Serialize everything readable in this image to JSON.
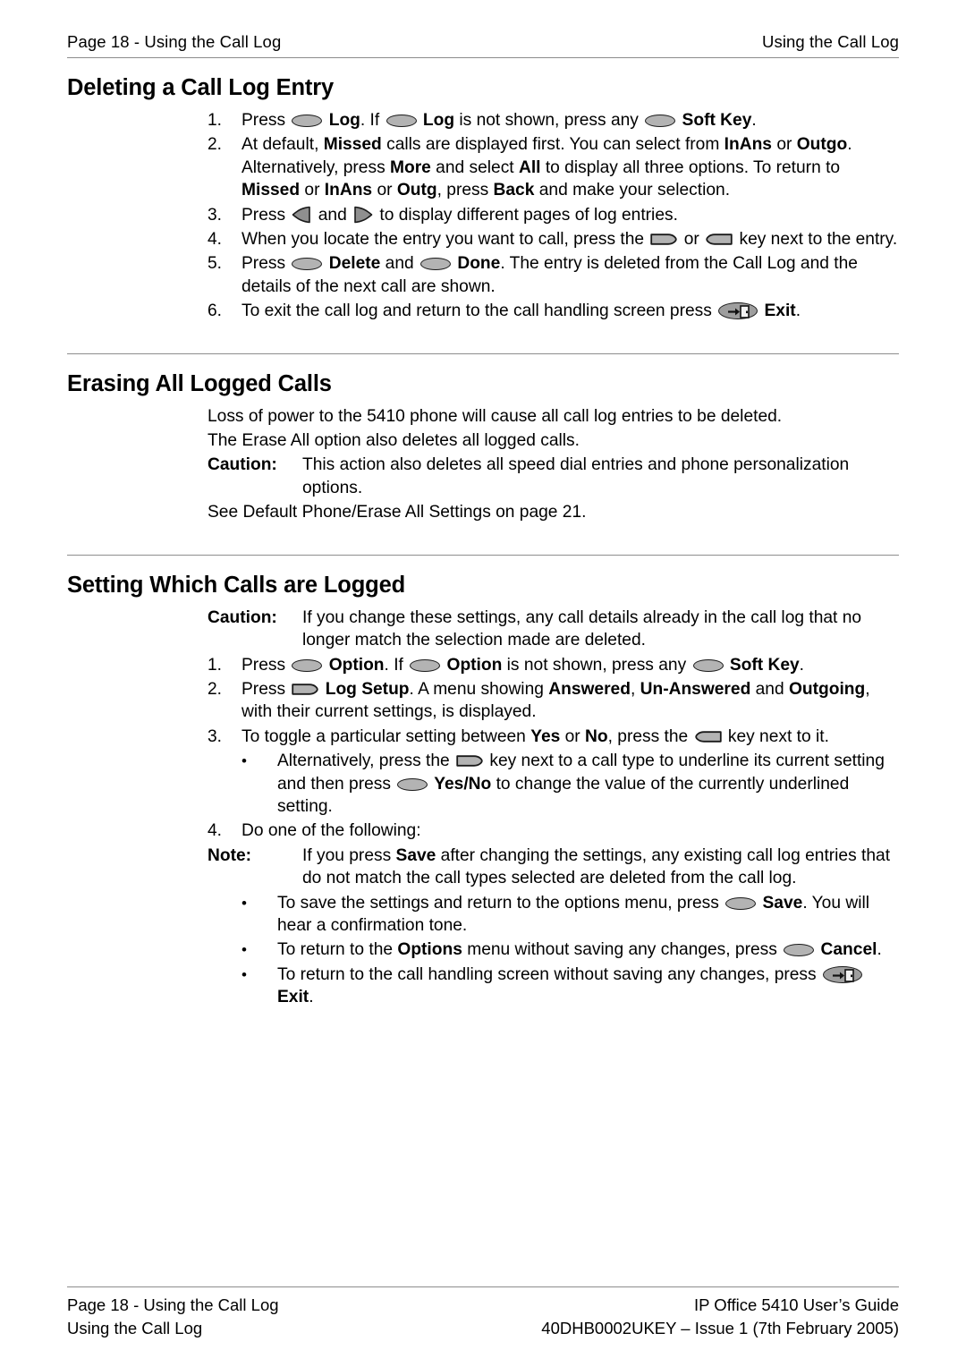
{
  "header": {
    "left": "Page 18 - Using the Call Log",
    "right": "Using the Call Log"
  },
  "sections": [
    {
      "title": "Deleting a Call Log Entry"
    },
    {
      "title": "Erasing All Logged Calls"
    },
    {
      "title": "Setting Which Calls are Logged"
    }
  ],
  "deleting": {
    "steps": [
      {
        "number": "1.",
        "parts": [
          {
            "t": "text",
            "v": "Press "
          },
          {
            "t": "icon",
            "v": "soft-key-icon"
          },
          {
            "t": "bold",
            "v": " Log"
          },
          {
            "t": "text",
            "v": ". If "
          },
          {
            "t": "icon",
            "v": "soft-key-icon"
          },
          {
            "t": "bold",
            "v": " Log"
          },
          {
            "t": "text",
            "v": " is not shown, press any "
          },
          {
            "t": "icon",
            "v": "soft-key-icon"
          },
          {
            "t": "bold",
            "v": " Soft Key"
          },
          {
            "t": "text",
            "v": "."
          }
        ]
      },
      {
        "number": "2.",
        "parts": [
          {
            "t": "text",
            "v": "At default, "
          },
          {
            "t": "bold",
            "v": "Missed"
          },
          {
            "t": "text",
            "v": " calls are displayed first. You can select from "
          },
          {
            "t": "bold",
            "v": "InAns"
          },
          {
            "t": "text",
            "v": " or "
          },
          {
            "t": "bold",
            "v": "Outgo"
          },
          {
            "t": "text",
            "v": ". Alternatively, press "
          },
          {
            "t": "bold",
            "v": "More"
          },
          {
            "t": "text",
            "v": " and select "
          },
          {
            "t": "bold",
            "v": "All"
          },
          {
            "t": "text",
            "v": " to display all three options. To return to "
          },
          {
            "t": "bold",
            "v": "Missed"
          },
          {
            "t": "text",
            "v": " or "
          },
          {
            "t": "bold",
            "v": "InAns"
          },
          {
            "t": "text",
            "v": " or "
          },
          {
            "t": "bold",
            "v": "Outg"
          },
          {
            "t": "text",
            "v": ", press "
          },
          {
            "t": "bold",
            "v": "Back"
          },
          {
            "t": "text",
            "v": " and make your selection."
          }
        ]
      },
      {
        "number": "3.",
        "parts": [
          {
            "t": "text",
            "v": "Press "
          },
          {
            "t": "icon",
            "v": "arrow-left-icon"
          },
          {
            "t": "text",
            "v": " and "
          },
          {
            "t": "icon",
            "v": "arrow-right-icon"
          },
          {
            "t": "text",
            "v": " to display different pages of log entries."
          }
        ]
      },
      {
        "number": "4.",
        "parts": [
          {
            "t": "text",
            "v": "When you locate the entry you want to call, press the "
          },
          {
            "t": "icon",
            "v": "line-key-right-icon"
          },
          {
            "t": "text",
            "v": " or "
          },
          {
            "t": "icon",
            "v": "line-key-left-icon"
          },
          {
            "t": "text",
            "v": " key next to the entry."
          }
        ]
      },
      {
        "number": "5.",
        "parts": [
          {
            "t": "text",
            "v": "Press "
          },
          {
            "t": "icon",
            "v": "soft-key-icon"
          },
          {
            "t": "bold",
            "v": " Delete"
          },
          {
            "t": "text",
            "v": " and "
          },
          {
            "t": "icon",
            "v": "soft-key-icon"
          },
          {
            "t": "bold",
            "v": " Done"
          },
          {
            "t": "text",
            "v": ". The entry is deleted from the Call Log and the details of the next call are shown."
          }
        ]
      },
      {
        "number": "6.",
        "parts": [
          {
            "t": "text",
            "v": "To exit the call log and return to the call handling screen press "
          },
          {
            "t": "icon",
            "v": "exit-key-icon"
          },
          {
            "t": "bold",
            "v": " Exit"
          },
          {
            "t": "text",
            "v": "."
          }
        ]
      }
    ]
  },
  "erasing": {
    "paragraph_1": "Loss of power to the 5410 phone will cause all call log entries to be deleted.",
    "paragraph_2": "The Erase All option also deletes all logged calls.",
    "caution_label": "Caution:",
    "caution_text": "This action also deletes all speed dial entries and phone personalization options.",
    "paragraph_3": "See Default Phone/Erase All Settings on page 21."
  },
  "setting": {
    "caution_label": "Caution:",
    "caution_text": "If you change these settings, any call details already in the call log that no longer match the selection made are deleted.",
    "note_label": "Note:",
    "note_text": "If you press Save after changing the settings, any existing call log entries that do not match the call types selected are deleted from the call log.",
    "steps": [
      {
        "number": "1.",
        "parts": [
          {
            "t": "text",
            "v": "Press "
          },
          {
            "t": "icon",
            "v": "soft-key-icon"
          },
          {
            "t": "bold",
            "v": " Option"
          },
          {
            "t": "text",
            "v": ". If "
          },
          {
            "t": "icon",
            "v": "soft-key-icon"
          },
          {
            "t": "bold",
            "v": " Option"
          },
          {
            "t": "text",
            "v": " is not shown, press any "
          },
          {
            "t": "icon",
            "v": "soft-key-icon"
          },
          {
            "t": "bold",
            "v": " Soft Key"
          },
          {
            "t": "text",
            "v": "."
          }
        ]
      },
      {
        "number": "2.",
        "parts": [
          {
            "t": "text",
            "v": "Press "
          },
          {
            "t": "icon",
            "v": "line-key-right-icon"
          },
          {
            "t": "bold",
            "v": " Log Setup"
          },
          {
            "t": "text",
            "v": ". A menu showing "
          },
          {
            "t": "bold",
            "v": "Answered"
          },
          {
            "t": "text",
            "v": ", "
          },
          {
            "t": "bold",
            "v": "Un-Answered"
          },
          {
            "t": "text",
            "v": " and "
          },
          {
            "t": "bold",
            "v": "Outgoing"
          },
          {
            "t": "text",
            "v": ", with their current settings, is displayed."
          }
        ]
      },
      {
        "number": "3.",
        "parts": [
          {
            "t": "text",
            "v": "To toggle a particular setting between "
          },
          {
            "t": "bold",
            "v": "Yes"
          },
          {
            "t": "text",
            "v": " or "
          },
          {
            "t": "bold",
            "v": "No"
          },
          {
            "t": "text",
            "v": ", press the "
          },
          {
            "t": "icon",
            "v": "line-key-left-icon"
          },
          {
            "t": "text",
            "v": " key next to it."
          }
        ]
      },
      {
        "number": "4.",
        "parts": [
          {
            "t": "text",
            "v": "Do one of the following:"
          }
        ]
      }
    ],
    "bullet_alternatively": {
      "marker": "•",
      "parts": [
        {
          "t": "text",
          "v": "Alternatively, press the "
        },
        {
          "t": "icon",
          "v": "line-key-right-icon"
        },
        {
          "t": "text",
          "v": " key next to a call type to underline its current setting and then press "
        },
        {
          "t": "icon",
          "v": "soft-key-icon"
        },
        {
          "t": "bold",
          "v": " Yes/No"
        },
        {
          "t": "text",
          "v": " to change the value of the currently underlined setting."
        }
      ]
    },
    "note_parts": [
      {
        "t": "text",
        "v": "If you press "
      },
      {
        "t": "bold",
        "v": "Save"
      },
      {
        "t": "text",
        "v": " after changing the settings, any existing call log entries that do not match the call types selected are deleted from the call log."
      }
    ],
    "bullets": [
      {
        "marker": "•",
        "parts": [
          {
            "t": "text",
            "v": "To save the settings and return to the options menu, press "
          },
          {
            "t": "icon",
            "v": "soft-key-icon"
          },
          {
            "t": "bold",
            "v": " Save"
          },
          {
            "t": "text",
            "v": ". You will hear a confirmation tone."
          }
        ]
      },
      {
        "marker": "•",
        "parts": [
          {
            "t": "text",
            "v": "To return to the "
          },
          {
            "t": "bold",
            "v": "Options"
          },
          {
            "t": "text",
            "v": " menu without saving any changes, press "
          },
          {
            "t": "icon",
            "v": "soft-key-icon"
          },
          {
            "t": "text",
            "v": " "
          },
          {
            "t": "bold",
            "v": "Cancel"
          },
          {
            "t": "text",
            "v": "."
          }
        ]
      },
      {
        "marker": "•",
        "parts": [
          {
            "t": "text",
            "v": "To return to the call handling screen without saving any changes, press "
          },
          {
            "t": "icon",
            "v": "exit-key-icon"
          },
          {
            "t": "text",
            "v": " "
          },
          {
            "t": "bold",
            "v": "Exit"
          },
          {
            "t": "text",
            "v": "."
          }
        ]
      }
    ]
  },
  "footer": {
    "line1_left": "Page 18 - Using the Call Log",
    "line1_right": "IP Office 5410 User’s Guide",
    "line2_left": "Using the Call Log",
    "line2_right": "40DHB0002UKEY – Issue 1 (7th February 2005)"
  },
  "colors": {
    "key_fill": "#b3b3b3",
    "key_stroke": "#1a1a1a",
    "rule": "#8d8d8d"
  }
}
